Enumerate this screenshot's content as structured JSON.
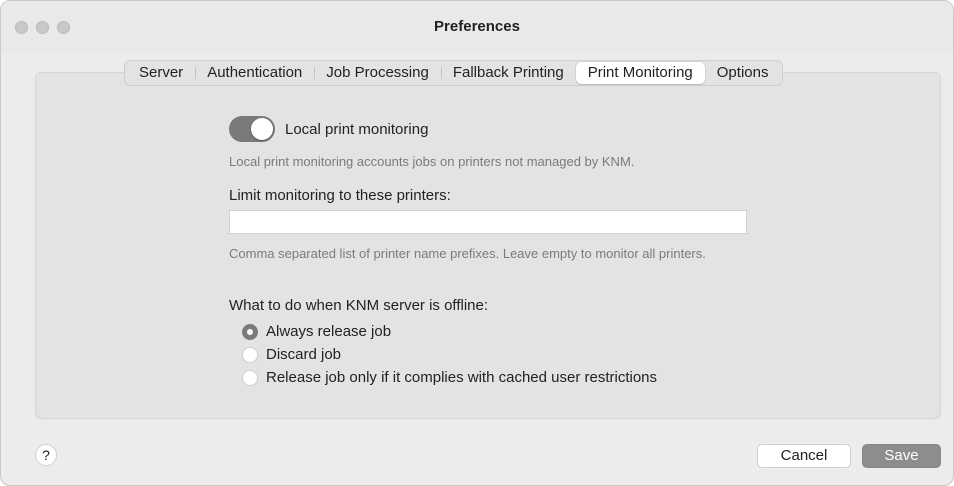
{
  "window": {
    "title": "Preferences"
  },
  "tabs": [
    {
      "label": "Server"
    },
    {
      "label": "Authentication"
    },
    {
      "label": "Job Processing"
    },
    {
      "label": "Fallback Printing"
    },
    {
      "label": "Print Monitoring",
      "active": true
    },
    {
      "label": "Options"
    }
  ],
  "monitoring": {
    "toggle_label": "Local print monitoring",
    "toggle_on": true,
    "toggle_help": "Local print monitoring accounts jobs on printers not managed by KNM.",
    "limit_label": "Limit monitoring to these printers:",
    "limit_value": "",
    "limit_help": "Comma separated list of printer name prefixes. Leave empty to monitor all printers."
  },
  "offline": {
    "label": "What to do when KNM server is offline:",
    "options": [
      {
        "label": "Always release job",
        "checked": true
      },
      {
        "label": "Discard job",
        "checked": false
      },
      {
        "label": "Release job only if it complies with cached user restrictions",
        "checked": false
      }
    ]
  },
  "footer": {
    "help_label": "?",
    "cancel_label": "Cancel",
    "save_label": "Save"
  },
  "colors": {
    "window_bg": "#ececec",
    "panel_bg": "#e3e3e3",
    "toggle_on": "#7a7a7a",
    "save_button": "#8d8d8d"
  }
}
